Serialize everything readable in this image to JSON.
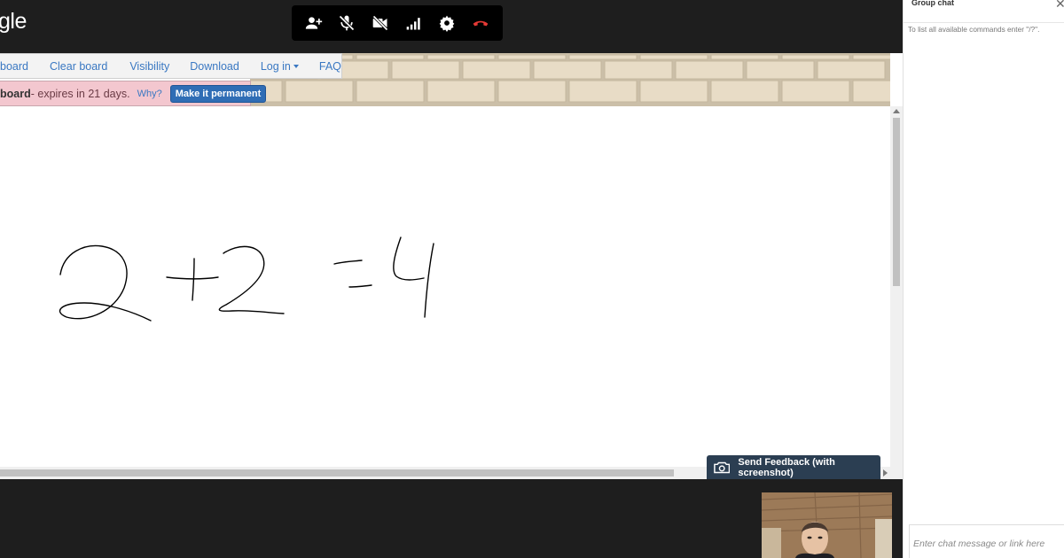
{
  "app": {
    "logo_text": "gle"
  },
  "call_controls": [
    {
      "icon": "add-person-icon",
      "color": "#ffffff"
    },
    {
      "icon": "mic-off-icon",
      "color": "#ffffff"
    },
    {
      "icon": "video-off-icon",
      "color": "#ffffff"
    },
    {
      "icon": "signal-icon",
      "color": "#ffffff"
    },
    {
      "icon": "gear-icon",
      "color": "#ffffff"
    },
    {
      "icon": "hang-up-icon",
      "color": "#e53935"
    }
  ],
  "menu": {
    "items": [
      "board",
      "Clear board",
      "Visibility",
      "Download",
      "Log in",
      "FAQ"
    ]
  },
  "notice": {
    "board": "board",
    "expires": " - expires in 21 days.",
    "why": "Why?",
    "permanent_button": "Make it permanent"
  },
  "drawing": {
    "content": "2 + 2 = 4"
  },
  "feedback": {
    "label": "Send Feedback (with screenshot)"
  },
  "chat": {
    "title": "Group chat",
    "close": "✕",
    "help": "To list all available commands enter \"/?\".",
    "input_placeholder": "Enter chat message or link here"
  },
  "colors": {
    "link": "#3a78c2",
    "notice_bg": "#f3c7cf",
    "button_blue": "#2f6db5",
    "dark": "#1e1e1e",
    "feedback_bg": "#2b3e52",
    "hangup_red": "#e53935"
  }
}
